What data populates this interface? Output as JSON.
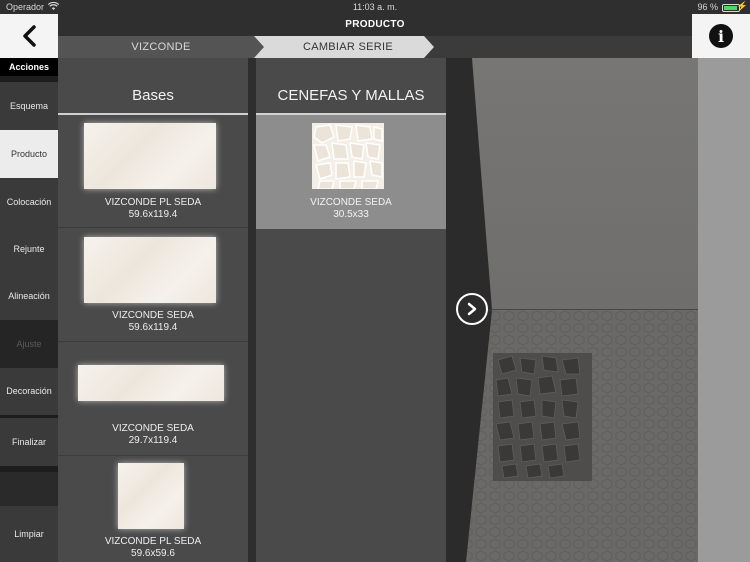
{
  "status_bar": {
    "carrier": "Operador",
    "time": "11:03 a. m.",
    "battery": "96 %",
    "battery_color": "#4cd964"
  },
  "header": {
    "title": "PRODUCTO",
    "back_icon": "chevron-left-icon",
    "info_icon": "info-icon",
    "info_label": "i"
  },
  "breadcrumb": {
    "items": [
      "VIZCONDE",
      "CAMBIAR SERIE"
    ]
  },
  "sidebar": {
    "title": "Acciones",
    "items": [
      {
        "label": "Esquema",
        "state": "normal"
      },
      {
        "label": "Producto",
        "state": "selected"
      },
      {
        "label": "Colocación",
        "state": "normal"
      },
      {
        "label": "Rejunte",
        "state": "normal"
      },
      {
        "label": "Alineación",
        "state": "normal"
      },
      {
        "label": "Ajuste",
        "state": "disabled"
      },
      {
        "label": "Decoración",
        "state": "normal"
      },
      {
        "label": "Finalizar",
        "state": "normal"
      },
      {
        "label": "Limpiar",
        "state": "normal"
      }
    ]
  },
  "bases": {
    "title": "Bases",
    "items": [
      {
        "name": "VIZCONDE PL SEDA",
        "size": "59.6x119.4"
      },
      {
        "name": "VIZCONDE SEDA",
        "size": "59.6x119.4"
      },
      {
        "name": "VIZCONDE SEDA",
        "size": "29.7x119.4"
      },
      {
        "name": "VIZCONDE PL SEDA",
        "size": "59.6x59.6"
      }
    ]
  },
  "cenefas": {
    "title": "CENEFAS Y MALLAS",
    "items": [
      {
        "name": "VIZCONDE SEDA",
        "size": "30.5x33"
      }
    ]
  },
  "preview": {
    "expand_icon": "chevron-right-circle-icon"
  }
}
